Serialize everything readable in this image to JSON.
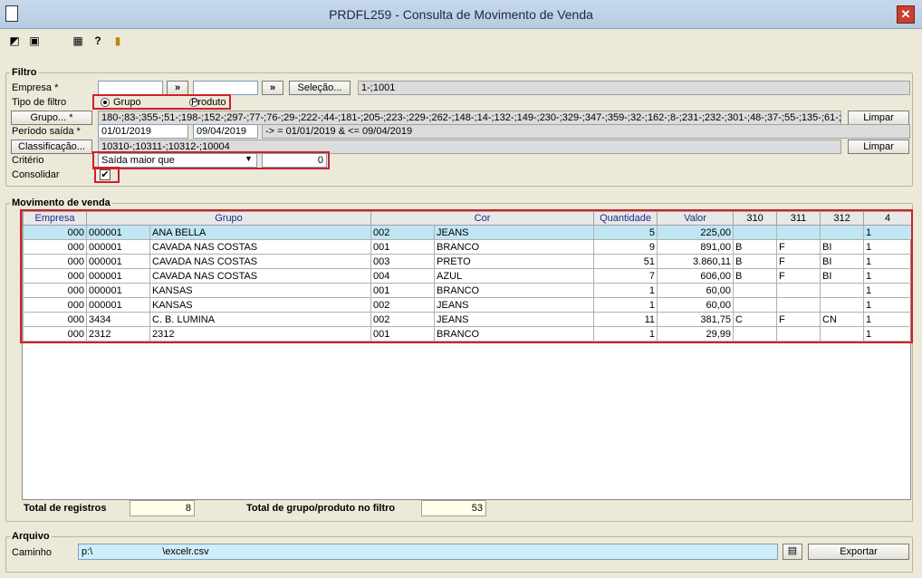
{
  "window": {
    "title": "PRDFL259 - Consulta de Movimento de Venda",
    "close": "✕"
  },
  "filtro": {
    "legend": "Filtro",
    "empresa_label": "Empresa *",
    "empresa_value": "",
    "empresa_value2": "",
    "arrow": "»",
    "selecao_button": "Seleção...",
    "selecao_value": "1-;1001",
    "tipo_label": "Tipo de filtro",
    "tipo_grupo": "Grupo",
    "tipo_produto": "Produto",
    "grupo_button": "Grupo... *",
    "grupo_value": "180-;83-;355-;51-;198-;152-;297-;77-;76-;29-;222-;44-;181-;205-;223-;229-;262-;148-;14-;132-;149-;230-;329-;347-;359-;32-;162-;8-;231-;232-;301-;48-;37-;55-;135-;61-;",
    "limpar": "Limpar",
    "periodo_label": "Período saída *",
    "periodo_inicio": "01/01/2019",
    "periodo_fim": "09/04/2019",
    "periodo_expr": "-> = 01/01/2019  & <= 09/04/2019",
    "classificacao_button": "Classificação...",
    "classificacao_value": "10310-;10311-;10312-;10004",
    "criterio_label": "Critério",
    "criterio_value": "Saída maior que",
    "criterio_number": "0",
    "consolidar_label": "Consolidar",
    "consolidar_check": "✔"
  },
  "movimento": {
    "legend": "Movimento de venda",
    "headers": [
      "Empresa",
      "Grupo",
      "Cor",
      "Quantidade",
      "Valor",
      "310",
      "311",
      "312",
      "4"
    ],
    "rows": [
      [
        "000",
        "000001",
        "ANA BELLA",
        "002",
        "JEANS",
        "5",
        "225,00",
        "",
        "",
        "",
        "1"
      ],
      [
        "000",
        "000001",
        "CAVADA NAS COSTAS",
        "001",
        "BRANCO",
        "9",
        "891,00",
        "B",
        "F",
        "BI",
        "1"
      ],
      [
        "000",
        "000001",
        "CAVADA NAS COSTAS",
        "003",
        "PRETO",
        "51",
        "3.860,11",
        "B",
        "F",
        "BI",
        "1"
      ],
      [
        "000",
        "000001",
        "CAVADA NAS COSTAS",
        "004",
        "AZUL",
        "7",
        "606,00",
        "B",
        "F",
        "BI",
        "1"
      ],
      [
        "000",
        "000001",
        "KANSAS",
        "001",
        "BRANCO",
        "1",
        "60,00",
        "",
        "",
        "",
        "1"
      ],
      [
        "000",
        "000001",
        "KANSAS",
        "002",
        "JEANS",
        "1",
        "60,00",
        "",
        "",
        "",
        "1"
      ],
      [
        "000",
        "3434",
        "C. B. LUMINA",
        "002",
        "JEANS",
        "11",
        "381,75",
        "C",
        "F",
        "CN",
        "1"
      ],
      [
        "000",
        "2312",
        "2312",
        "001",
        "BRANCO",
        "1",
        "29,99",
        "",
        "",
        "",
        "1"
      ]
    ],
    "total_registros_label": "Total de registros",
    "total_registros": "8",
    "total_grupo_label": "Total de grupo/produto no filtro",
    "total_grupo": "53"
  },
  "arquivo": {
    "legend": "Arquivo",
    "caminho_label": "Caminho",
    "caminho_value": "p:\\       \\excelr.csv",
    "exportar_button": "Exportar"
  },
  "colors": {
    "selected_row": "#bfe6f3",
    "highlight": "#d0202a",
    "path_input": "#cdeefa"
  }
}
